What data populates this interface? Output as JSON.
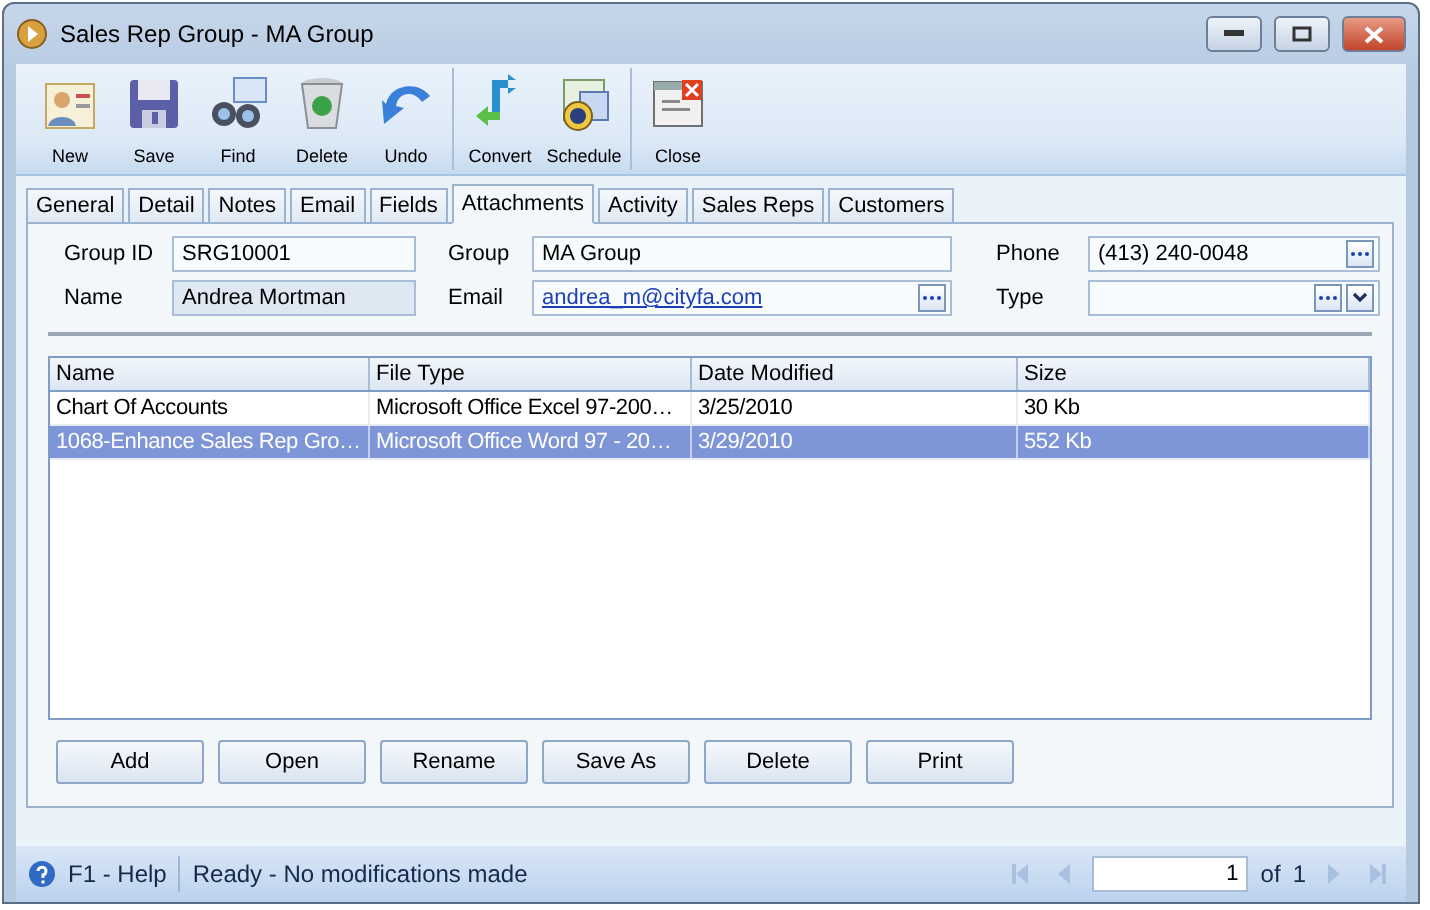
{
  "window": {
    "title": "Sales Rep Group - MA Group"
  },
  "toolbar": [
    [
      {
        "label": "New",
        "kind": "new"
      },
      {
        "label": "Save",
        "kind": "save"
      },
      {
        "label": "Find",
        "kind": "find"
      },
      {
        "label": "Delete",
        "kind": "delete"
      },
      {
        "label": "Undo",
        "kind": "undo"
      }
    ],
    [
      {
        "label": "Convert",
        "kind": "convert"
      },
      {
        "label": "Schedule",
        "kind": "schedule"
      }
    ],
    [
      {
        "label": "Close",
        "kind": "close"
      }
    ]
  ],
  "tabs": [
    {
      "label": "General",
      "selected": false
    },
    {
      "label": "Detail",
      "selected": false
    },
    {
      "label": "Notes",
      "selected": false
    },
    {
      "label": "Email",
      "selected": false
    },
    {
      "label": "Fields",
      "selected": false
    },
    {
      "label": "Attachments",
      "selected": true
    },
    {
      "label": "Activity",
      "selected": false
    },
    {
      "label": "Sales Reps",
      "selected": false
    },
    {
      "label": "Customers",
      "selected": false
    }
  ],
  "fields": [
    {
      "label": "Group ID",
      "value": "SRG10001",
      "kind": "text",
      "readonly": false
    },
    {
      "label": "Group",
      "value": "MA Group",
      "kind": "text",
      "readonly": false
    },
    {
      "label": "Phone",
      "value": "(413) 240-0048",
      "kind": "lookup",
      "readonly": false
    },
    {
      "label": "Name",
      "value": "Andrea Mortman",
      "kind": "text",
      "readonly": true
    },
    {
      "label": "Email",
      "value": "andrea_m@cityfa.com",
      "kind": "link",
      "readonly": false
    },
    {
      "label": "Type",
      "kind": "combo",
      "readonly": false
    }
  ],
  "table": {
    "columns": [
      "Name",
      "File Type",
      "Date Modified",
      "Size"
    ],
    "rows": [
      {
        "cells": [
          "Chart Of Accounts",
          "Microsoft Office Excel 97-200…",
          "3/25/2010",
          "30 Kb"
        ],
        "selected": false
      },
      {
        "cells": [
          "1068-Enhance Sales Rep Gro…",
          "Microsoft Office Word 97 - 20…",
          "3/29/2010",
          "552 Kb"
        ],
        "selected": true
      }
    ]
  },
  "buttons": [
    "Add",
    "Open",
    "Rename",
    "Save As",
    "Delete",
    "Print"
  ],
  "status_bar": {
    "help": "F1 - Help",
    "message": "Ready - No modifications made",
    "page": "1",
    "of": "of",
    "total": "1"
  }
}
